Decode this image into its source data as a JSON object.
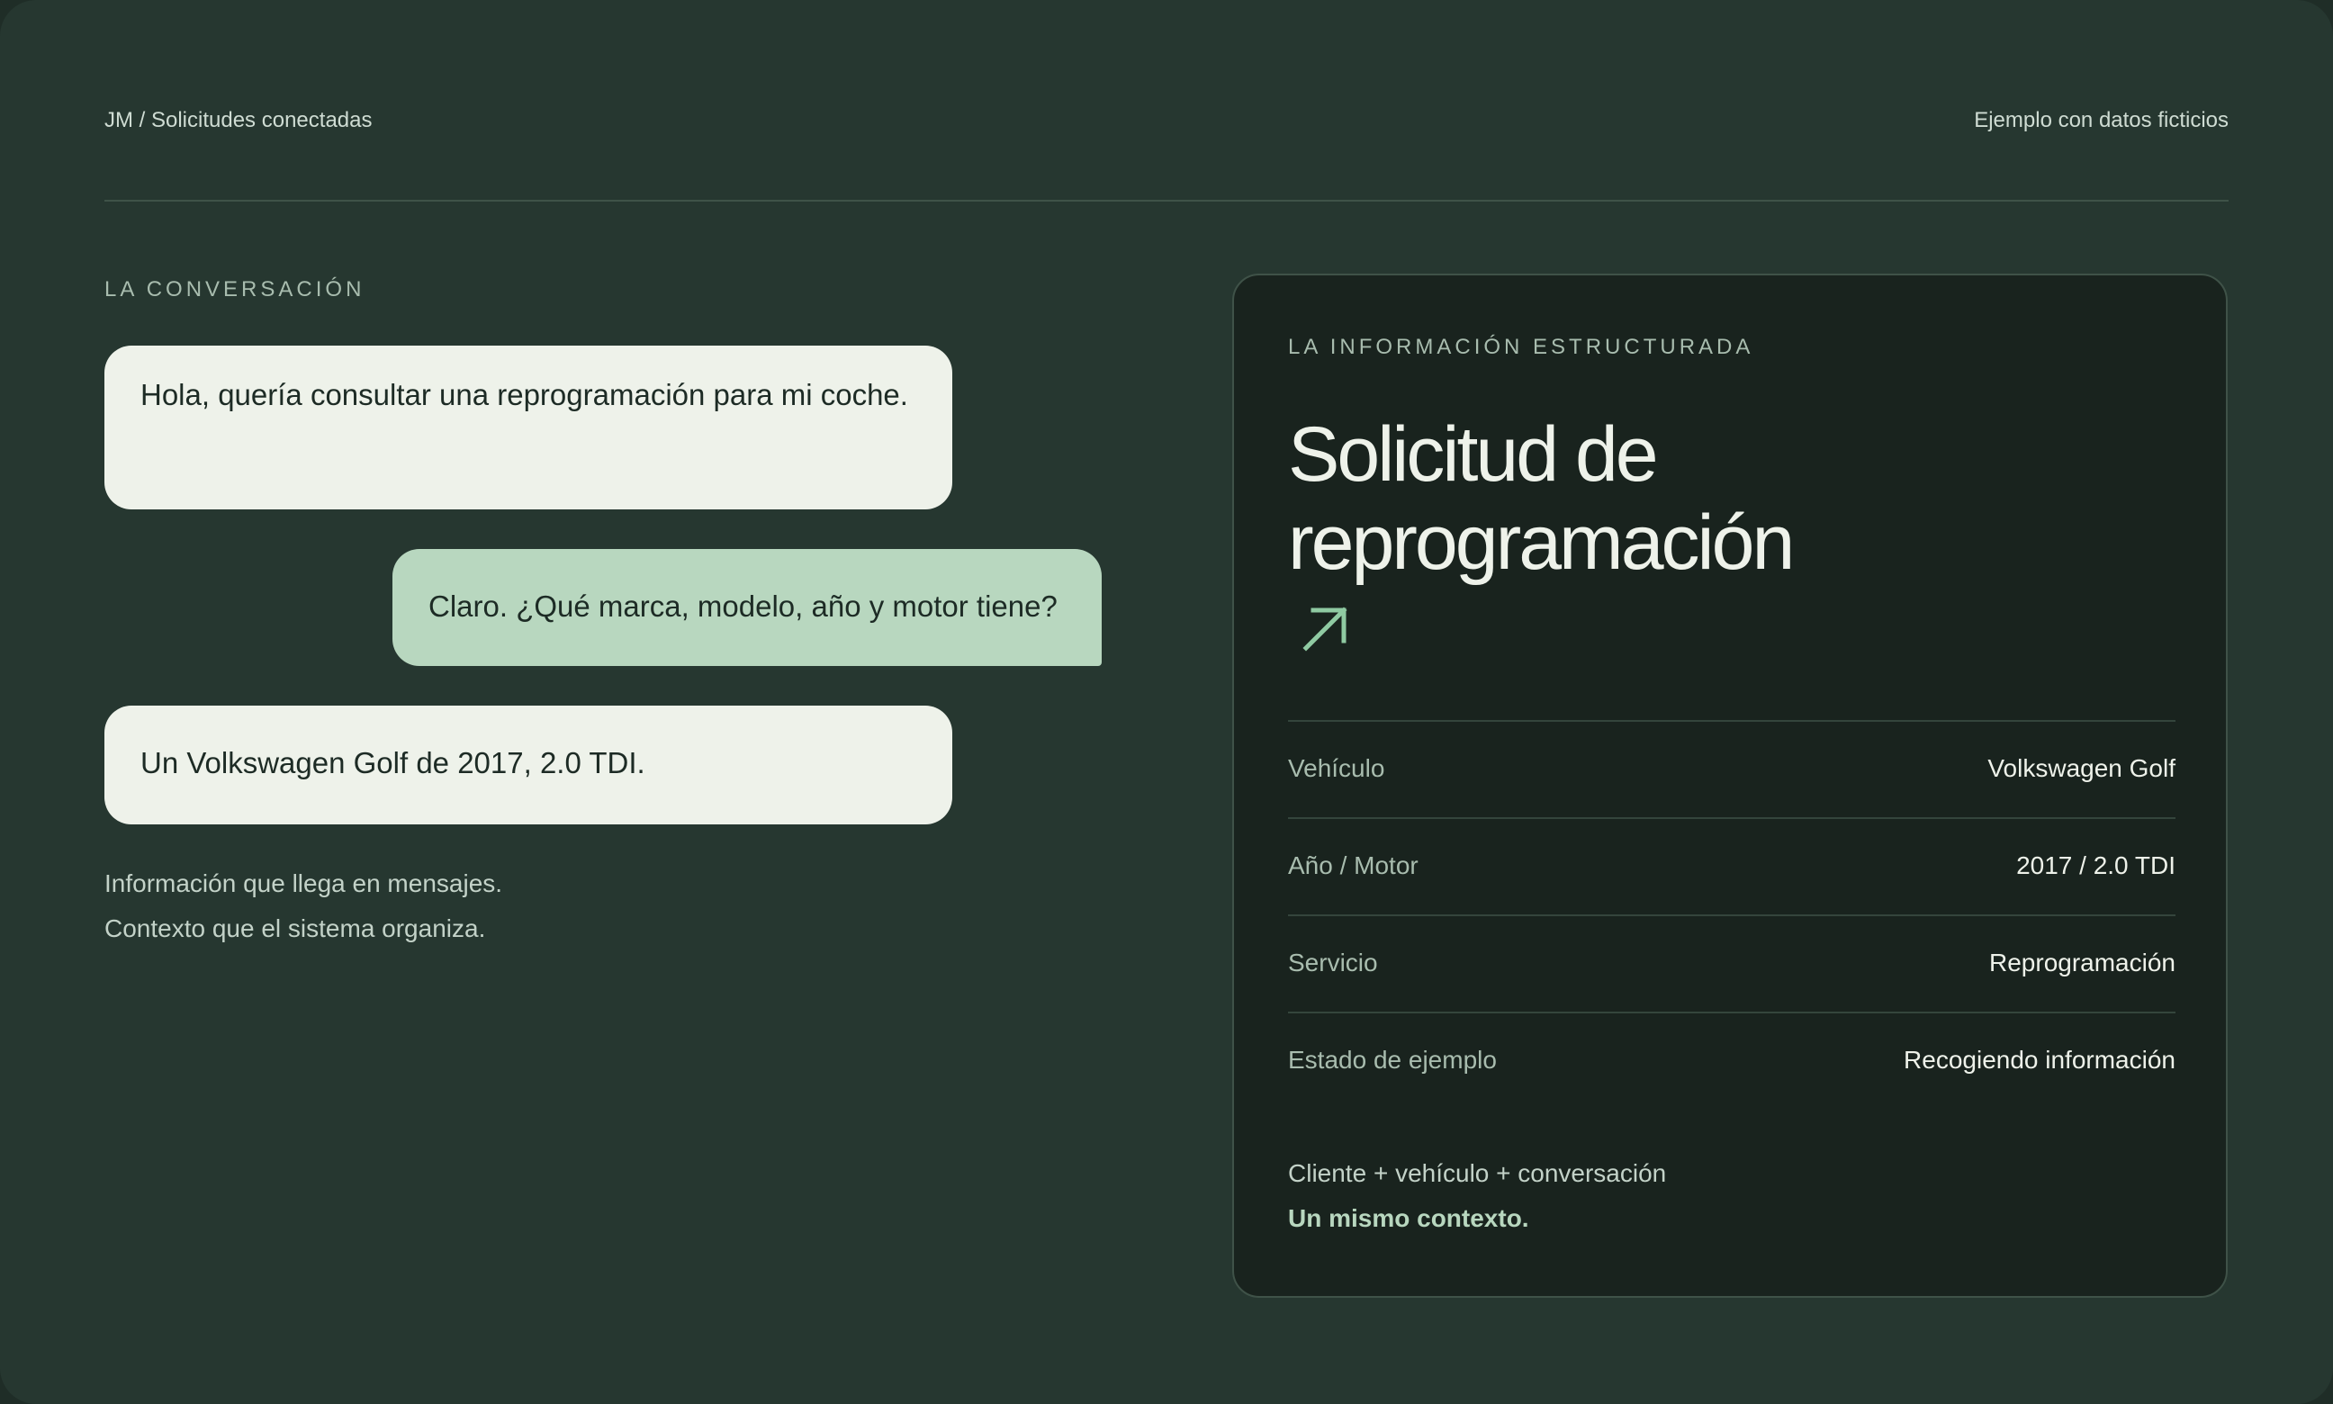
{
  "header": {
    "breadcrumb": "JM / Solicitudes conectadas",
    "note": "Ejemplo con datos ficticios"
  },
  "conversation": {
    "label": "LA CONVERSACIÓN",
    "messages": [
      {
        "role": "client",
        "text": "Hola, quería consultar una reprogramación para mi coche."
      },
      {
        "role": "agent",
        "text": "Claro. ¿Qué marca, modelo, año y motor tiene?"
      },
      {
        "role": "client",
        "text": "Un Volkswagen Golf de 2017, 2.0 TDI."
      }
    ],
    "caption_1": "Información que llega en mensajes.",
    "caption_2": "Contexto que el sistema organiza."
  },
  "card": {
    "label": "LA INFORMACIÓN ESTRUCTURADA",
    "title": "Solicitud de reprogramación",
    "icon": "arrow-up-right-icon",
    "rows": [
      {
        "label": "Vehículo",
        "value": "Volkswagen Golf"
      },
      {
        "label": "Año / Motor",
        "value": "2017 / 2.0 TDI"
      },
      {
        "label": "Servicio",
        "value": "Reprogramación"
      },
      {
        "label": "Estado de ejemplo",
        "value": "Recogiendo información"
      }
    ],
    "footer_line_1": "Cliente + vehículo + conversación",
    "footer_line_2": "Un mismo contexto."
  },
  "colors": {
    "background": "#263730",
    "card_background": "#19231e",
    "client_bubble": "#eef2ea",
    "agent_bubble": "#b8d7bf",
    "accent": "#8fcaa2"
  }
}
